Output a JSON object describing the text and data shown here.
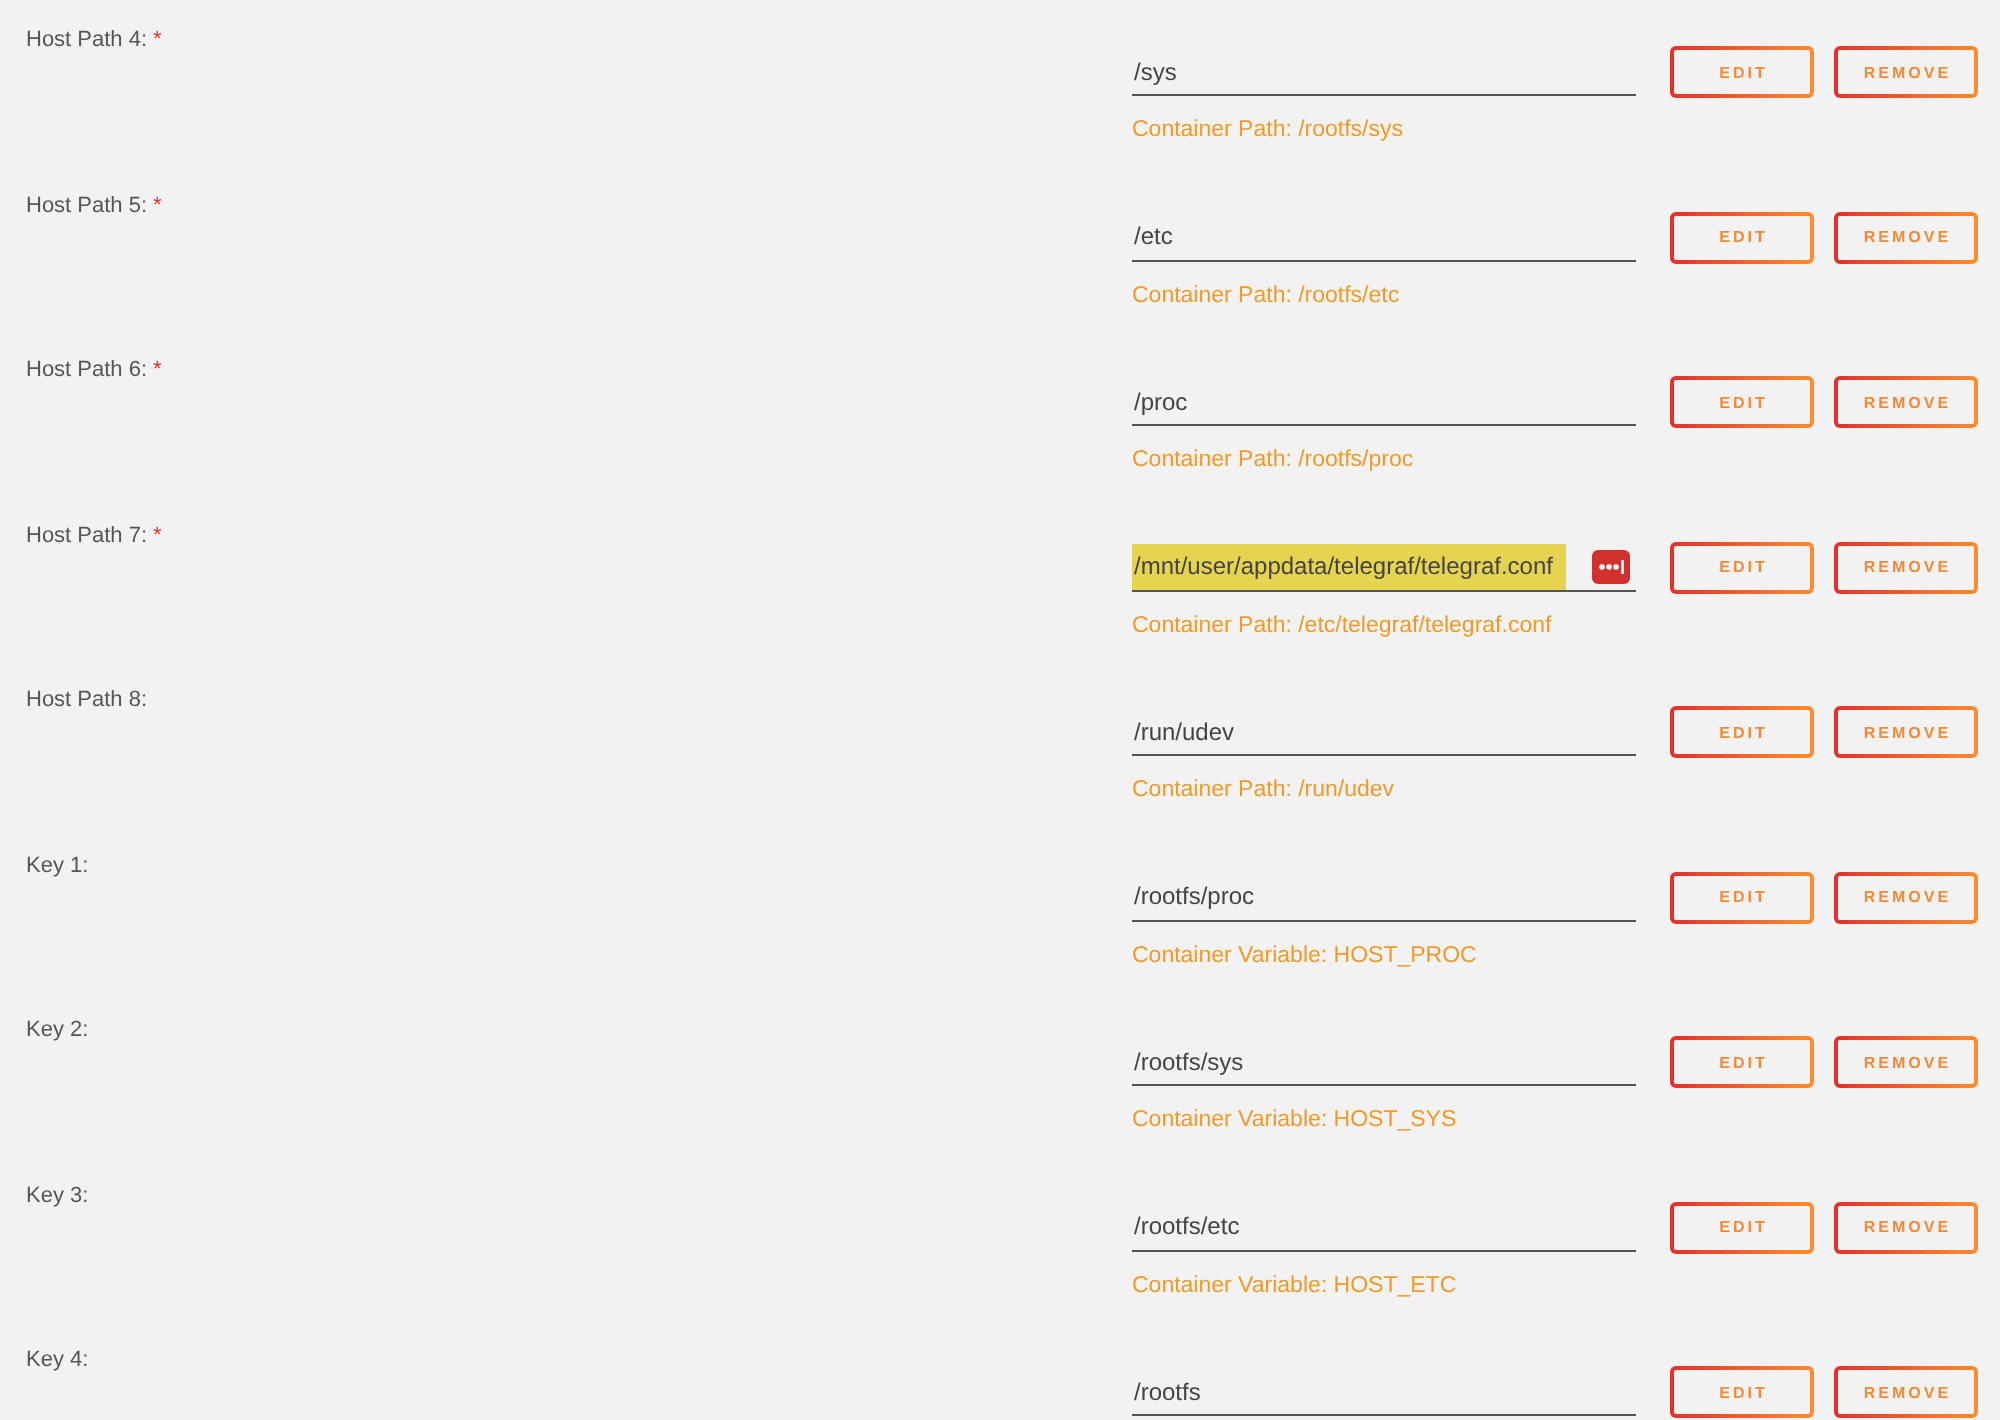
{
  "rows": [
    {
      "label": "Host Path 4:",
      "required_mark": "*",
      "value": "/sys",
      "highlighted": false,
      "note": "Container Path: /rootfs/sys",
      "buttons": [
        "EDIT",
        "REMOVE"
      ]
    },
    {
      "label": "Host Path 5:",
      "required_mark": "*",
      "value": "/etc",
      "highlighted": false,
      "note": "Container Path: /rootfs/etc",
      "buttons": [
        "EDIT",
        "REMOVE"
      ]
    },
    {
      "label": "Host Path 6:",
      "required_mark": "*",
      "value": "/proc",
      "highlighted": false,
      "note": "Container Path: /rootfs/proc",
      "buttons": [
        "EDIT",
        "REMOVE"
      ]
    },
    {
      "label": "Host Path 7:",
      "required_mark": "*",
      "value": "/mnt/user/appdata/telegraf/telegraf.conf",
      "highlighted": true,
      "note": "Container Path: /etc/telegraf/telegraf.conf",
      "buttons": [
        "EDIT",
        "REMOVE"
      ]
    },
    {
      "label": "Host Path 8:",
      "value": "/run/udev",
      "highlighted": false,
      "note": "Container Path: /run/udev",
      "buttons": [
        "EDIT",
        "REMOVE"
      ]
    },
    {
      "label": "Key 1:",
      "value": "/rootfs/proc",
      "highlighted": false,
      "note": "Container Variable: HOST_PROC",
      "buttons": [
        "EDIT",
        "REMOVE"
      ]
    },
    {
      "label": "Key 2:",
      "value": "/rootfs/sys",
      "highlighted": false,
      "note": "Container Variable: HOST_SYS",
      "buttons": [
        "EDIT",
        "REMOVE"
      ]
    },
    {
      "label": "Key 3:",
      "value": "/rootfs/etc",
      "highlighted": false,
      "note": "Container Variable: HOST_ETC",
      "buttons": [
        "EDIT",
        "REMOVE"
      ]
    },
    {
      "label": "Key 4:",
      "value": "/rootfs",
      "highlighted": false,
      "buttons": [
        "EDIT",
        "REMOVE"
      ]
    }
  ]
}
